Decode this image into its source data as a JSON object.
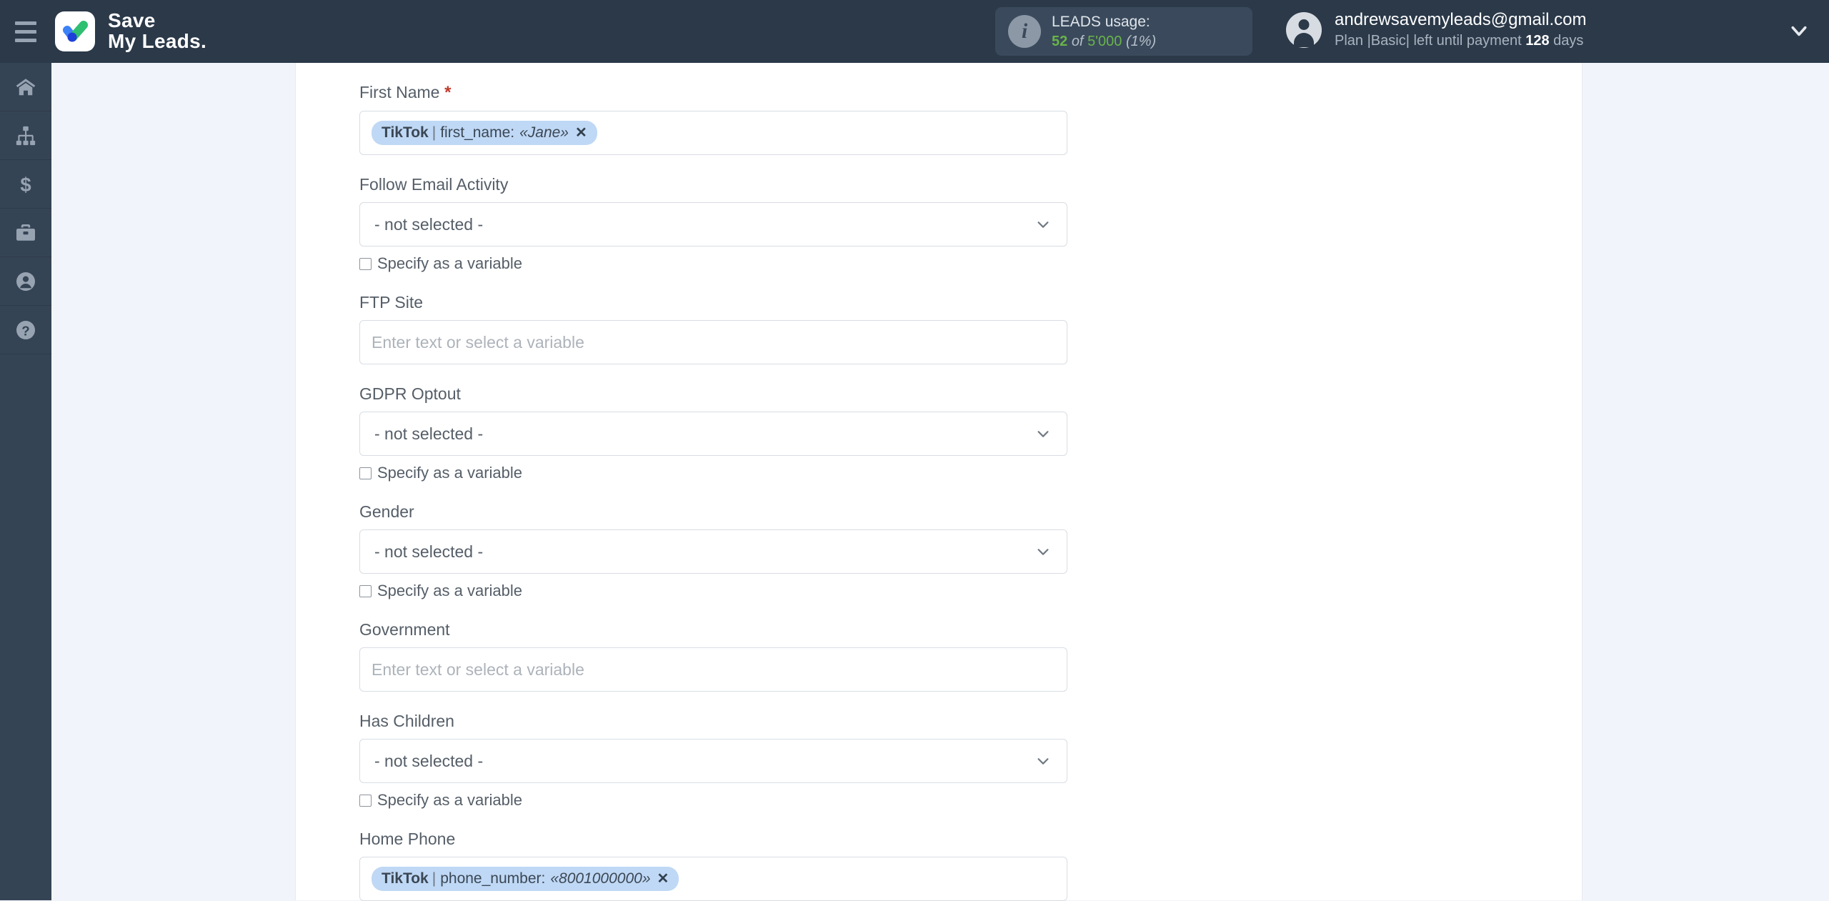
{
  "header": {
    "menu_icon": "hamburger-icon",
    "logo_icon": "savemyleads-check-logo",
    "brand_line1": "Save",
    "brand_line2": "My Leads.",
    "usage": {
      "info_icon": "info-icon",
      "title": "LEADS usage:",
      "used": "52",
      "of": "of",
      "total": "5'000",
      "percent": "(1%)"
    },
    "account": {
      "avatar_icon": "user-avatar-icon",
      "email": "andrewsavemyleads@gmail.com",
      "plan_prefix": "Plan |Basic| left until payment",
      "days": "128",
      "plan_suffix": "days",
      "caret_icon": "chevron-down-icon"
    }
  },
  "sidebar": {
    "items": [
      {
        "name": "home",
        "icon": "home-icon"
      },
      {
        "name": "connections",
        "icon": "sitemap-icon"
      },
      {
        "name": "billing",
        "icon": "dollar-icon"
      },
      {
        "name": "services",
        "icon": "briefcase-icon"
      },
      {
        "name": "profile",
        "icon": "user-circle-icon"
      },
      {
        "name": "help",
        "icon": "question-circle-icon"
      }
    ]
  },
  "form": {
    "placeholder_text": "Enter text or select a variable",
    "not_selected": "- not selected -",
    "variable_checkbox_label": "Specify as a variable",
    "required_marker": "*",
    "fields": [
      {
        "label": "First Name",
        "type": "tag",
        "required": true,
        "tag": {
          "source": "TikTok",
          "field": "first_name",
          "value": "«Jane»",
          "remove_icon": "close-icon"
        }
      },
      {
        "label": "Follow Email Activity",
        "type": "select",
        "required": false,
        "value": "- not selected -",
        "has_variable_checkbox": true
      },
      {
        "label": "FTP Site",
        "type": "text",
        "required": false,
        "value": "",
        "has_variable_checkbox": false
      },
      {
        "label": "GDPR Optout",
        "type": "select",
        "required": false,
        "value": "- not selected -",
        "has_variable_checkbox": true
      },
      {
        "label": "Gender",
        "type": "select",
        "required": false,
        "value": "- not selected -",
        "has_variable_checkbox": true
      },
      {
        "label": "Government",
        "type": "text",
        "required": false,
        "value": "",
        "has_variable_checkbox": false
      },
      {
        "label": "Has Children",
        "type": "select",
        "required": false,
        "value": "- not selected -",
        "has_variable_checkbox": true
      },
      {
        "label": "Home Phone",
        "type": "tag",
        "required": false,
        "tag": {
          "source": "TikTok",
          "field": "phone_number",
          "value": "«8001000000»",
          "remove_icon": "close-icon"
        }
      }
    ]
  },
  "colors": {
    "header_bg": "#2b3949",
    "sidebar_bg": "#354455",
    "page_bg": "#f1f4fa",
    "panel_bg": "#ffffff",
    "tag_bg": "#bfd8f5",
    "usage_green": "#6ab34a",
    "required_red": "#c0392b",
    "logo_green": "#2fbf71",
    "logo_blue": "#3b82f6",
    "logo_darkblue": "#1e40d8"
  }
}
